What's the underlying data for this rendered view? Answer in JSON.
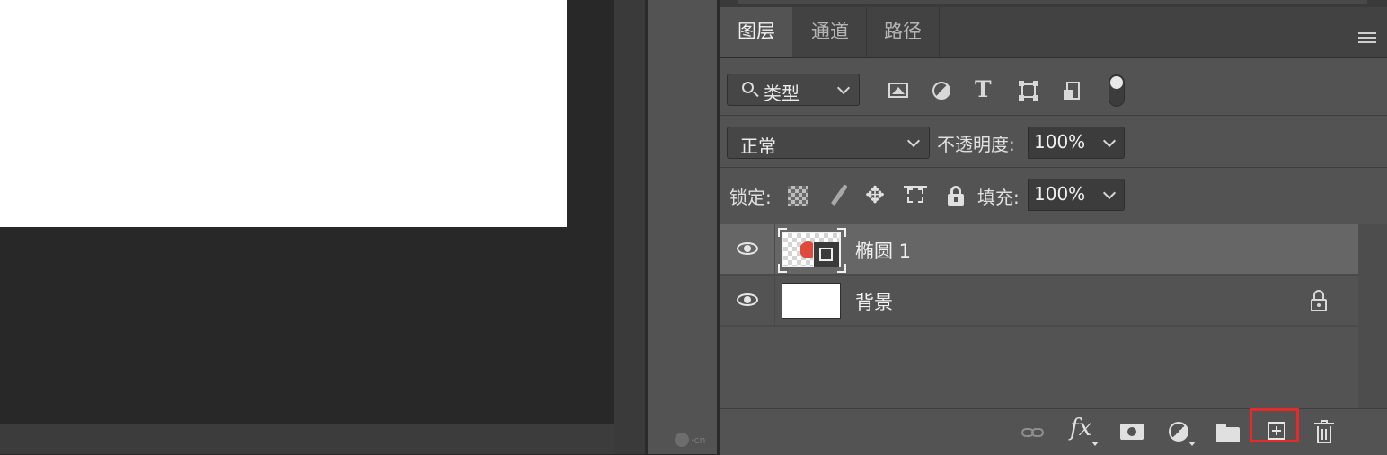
{
  "panel": {
    "tabs": [
      {
        "label": "图层",
        "active": true
      },
      {
        "label": "通道",
        "active": false
      },
      {
        "label": "路径",
        "active": false
      }
    ],
    "menu_icon": "hamburger-menu-icon"
  },
  "filter": {
    "kind_label": "类型",
    "icons": [
      "pixel-layer-filter-icon",
      "adjustment-layer-filter-icon",
      "type-layer-filter-icon",
      "shape-layer-filter-icon",
      "smart-object-filter-icon"
    ],
    "toggle": "on"
  },
  "blend": {
    "mode": "正常",
    "opacity_label": "不透明度:",
    "opacity_value": "100%"
  },
  "lock": {
    "label": "锁定:",
    "fill_label": "填充:",
    "fill_value": "100%"
  },
  "layers": [
    {
      "name": "椭圆 1",
      "visible": true,
      "selected": true,
      "type": "shape",
      "color": "#e04a3c"
    },
    {
      "name": "背景",
      "visible": true,
      "selected": false,
      "locked": true
    }
  ],
  "bottom_toolbar": {
    "fx_label": "fx",
    "highlight_color": "#e8292a"
  },
  "watermark": "·cn"
}
